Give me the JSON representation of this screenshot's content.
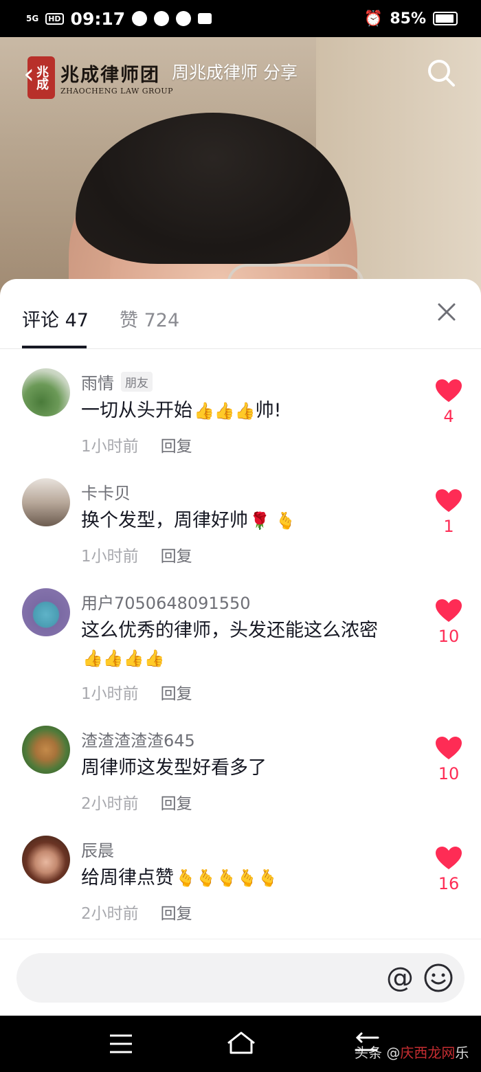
{
  "status_bar": {
    "network": "5G",
    "hd": "HD",
    "time": "09:17",
    "battery": "85%"
  },
  "video": {
    "logo_cn": "兆成律师团",
    "logo_en": "ZHAOCHENG LAW GROUP",
    "logo_seal": "兆成",
    "title": "周兆成律师 分享"
  },
  "tabs": {
    "comments": "评论 47",
    "likes": "赞 724"
  },
  "comments": [
    {
      "name": "雨情",
      "tag": "朋友",
      "text": "一切从头开始",
      "emoji": "👍👍👍",
      "text_after": "帅!",
      "time": "1小时前",
      "reply": "回复",
      "likes": "4"
    },
    {
      "name": "卡卡贝",
      "tag": "",
      "text": "换个发型，周律好帅",
      "emoji": "🌹 🫰",
      "text_after": "",
      "time": "1小时前",
      "reply": "回复",
      "likes": "1"
    },
    {
      "name": "用户7050648091550",
      "tag": "",
      "text": "这么优秀的律师，头发还能这么浓密",
      "emoji": "👍👍👍👍",
      "text_after": "",
      "time": "1小时前",
      "reply": "回复",
      "likes": "10"
    },
    {
      "name": "渣渣渣渣渣645",
      "tag": "",
      "text": "周律师这发型好看多了",
      "emoji": "",
      "text_after": "",
      "time": "2小时前",
      "reply": "回复",
      "likes": "10"
    },
    {
      "name": "辰晨",
      "tag": "",
      "text": "给周律点赞",
      "emoji": "🫰🫰🫰🫰🫰",
      "text_after": "",
      "time": "2小时前",
      "reply": "回复",
      "likes": "16"
    }
  ],
  "input": {
    "placeholder": ""
  },
  "watermark": {
    "left": "头条 @",
    "mid": "庆西龙网",
    "right": "乐"
  },
  "colors": {
    "like_red": "#fe2c55",
    "text_primary": "#161823",
    "text_secondary": "#6e6f76"
  }
}
